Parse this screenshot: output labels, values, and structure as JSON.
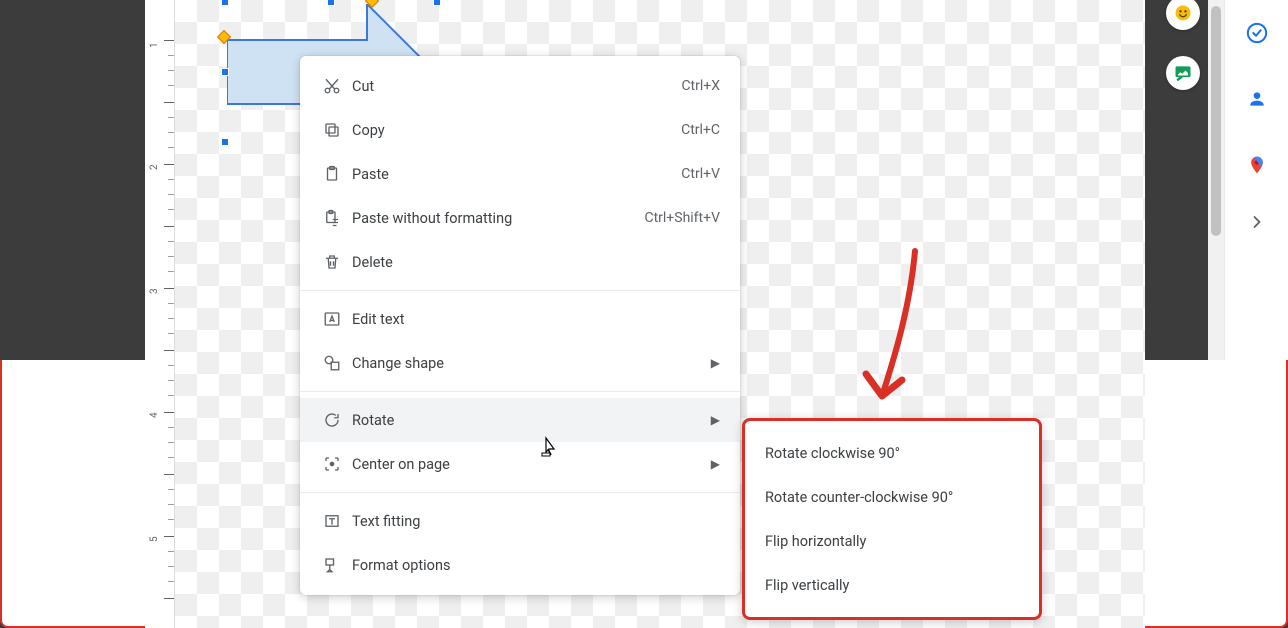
{
  "ruler": {
    "labels": [
      "1",
      "2",
      "3",
      "4",
      "5"
    ]
  },
  "menu": {
    "cut": {
      "label": "Cut",
      "accel": "Ctrl+X"
    },
    "copy": {
      "label": "Copy",
      "accel": "Ctrl+C"
    },
    "paste": {
      "label": "Paste",
      "accel": "Ctrl+V"
    },
    "paste_no_fmt": {
      "label": "Paste without formatting",
      "accel": "Ctrl+Shift+V"
    },
    "delete": {
      "label": "Delete"
    },
    "edit_text": {
      "label": "Edit text"
    },
    "change_shape": {
      "label": "Change shape"
    },
    "rotate": {
      "label": "Rotate"
    },
    "center": {
      "label": "Center on page"
    },
    "text_fitting": {
      "label": "Text fitting"
    },
    "format_options": {
      "label": "Format options"
    }
  },
  "submenu": {
    "rotate_cw": "Rotate clockwise 90°",
    "rotate_ccw": "Rotate counter-clockwise 90°",
    "flip_h": "Flip horizontally",
    "flip_v": "Flip vertically"
  },
  "colors": {
    "shape_fill": "#cfe2f3",
    "shape_stroke": "#3c78d8",
    "highlight_red": "#d93025"
  }
}
